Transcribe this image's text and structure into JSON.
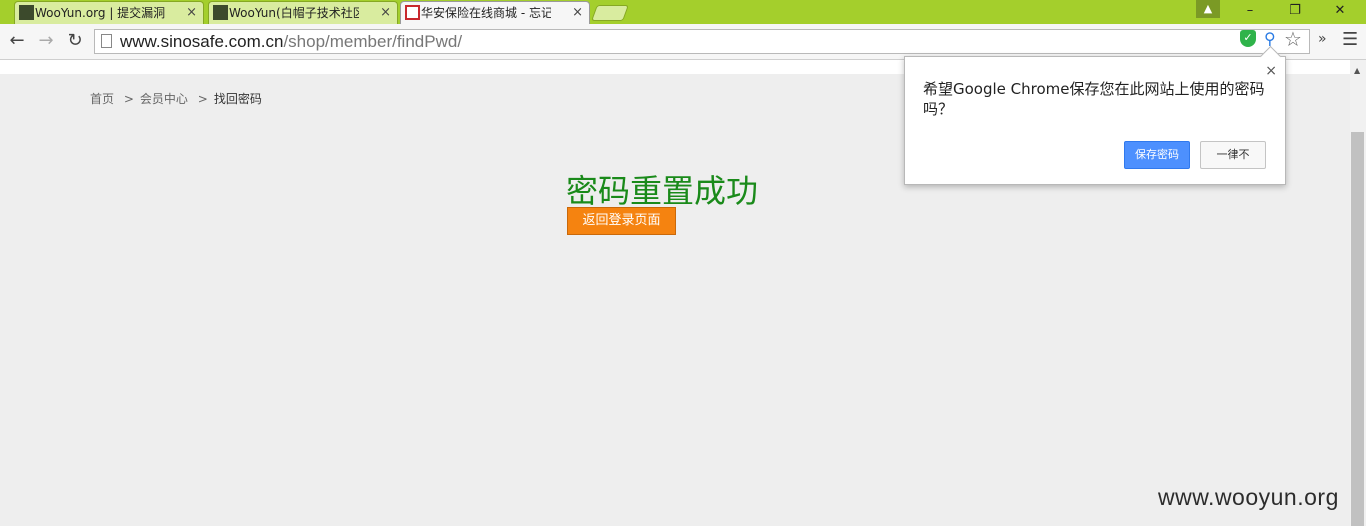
{
  "browser": {
    "tabs": [
      {
        "label": "WooYun.org | 提交漏洞",
        "active": false
      },
      {
        "label": "WooYun(白帽子技术社区",
        "active": false
      },
      {
        "label": "华安保险在线商城 - 忘记密",
        "active": true
      }
    ],
    "tab_close": "×",
    "address": {
      "host": "www.sinosafe.com.cn",
      "path": "/shop/member/findPwd/"
    },
    "window": {
      "minimize": "–",
      "restore": "❐",
      "close": "✕"
    },
    "accent_color": "#a4cf2c"
  },
  "breadcrumb": {
    "items": [
      "首页",
      "会员中心",
      "找回密码"
    ],
    "separator": ">"
  },
  "main": {
    "title": "密码重置成功",
    "title_color": "#1a8a1a",
    "return_button": "返回登录页面",
    "button_color": "#f58310"
  },
  "password_bubble": {
    "message": "希望Google Chrome保存您在此网站上使用的密码吗？",
    "save_button": "保存密码",
    "never_button": "一律不",
    "close": "×"
  },
  "watermark": "www.wooyun.org"
}
